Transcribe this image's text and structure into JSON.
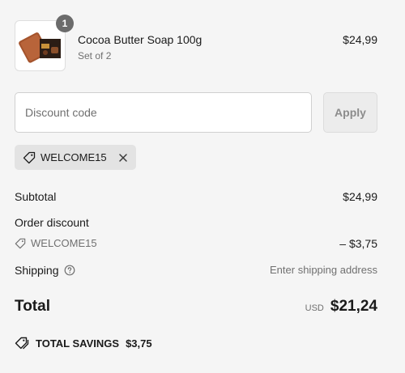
{
  "product": {
    "quantity": "1",
    "name": "Cocoa Butter Soap 100g",
    "variant": "Set of 2",
    "price": "$24,99",
    "image_icon": "soap-product-image"
  },
  "discount": {
    "placeholder": "Discount code",
    "value": "",
    "apply_label": "Apply",
    "applied_code": "WELCOME15"
  },
  "summary": {
    "subtotal_label": "Subtotal",
    "subtotal_value": "$24,99",
    "order_discount_label": "Order discount",
    "order_discount_code": "WELCOME15",
    "order_discount_value": "– $3,75",
    "shipping_label": "Shipping",
    "shipping_value": "Enter shipping address",
    "total_label": "Total",
    "currency": "USD",
    "total_value": "$21,24",
    "savings_label": "TOTAL SAVINGS",
    "savings_value": "$3,75"
  },
  "colors": {
    "background": "#f5f5f5",
    "badge": "#6b6b6b",
    "chip": "#e3e3e3",
    "muted_text": "#707070"
  }
}
